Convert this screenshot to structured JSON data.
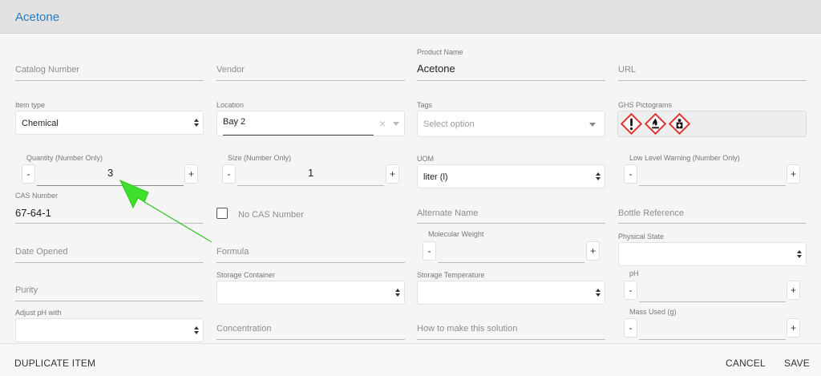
{
  "header": {
    "title": "Acetone"
  },
  "form": {
    "catalog_number": {
      "placeholder": "Catalog Number"
    },
    "vendor": {
      "placeholder": "Vendor"
    },
    "product_name": {
      "label": "Product Name",
      "value": "Acetone"
    },
    "url": {
      "placeholder": "URL"
    },
    "item_type": {
      "label": "Item type",
      "value": "Chemical"
    },
    "location": {
      "label": "Location",
      "value": "Bay 2",
      "clear": "×"
    },
    "tags": {
      "label": "Tags",
      "placeholder": "Select option"
    },
    "ghs": {
      "label": "GHS Pictograms",
      "icons": [
        "exclamation-mark-icon",
        "flame-icon",
        "health-hazard-icon"
      ]
    },
    "quantity": {
      "label": "Quantity (Number Only)",
      "value": "3",
      "minus": "-",
      "plus": "+"
    },
    "size": {
      "label": "Size (Number Only)",
      "value": "1",
      "minus": "-",
      "plus": "+"
    },
    "uom": {
      "label": "UOM",
      "value": "liter (l)"
    },
    "low_level": {
      "label": "Low Level Warning (Number Only)",
      "value": "",
      "minus": "-",
      "plus": "+"
    },
    "cas_number": {
      "label": "CAS Number",
      "value": "67-64-1"
    },
    "no_cas": {
      "label": "No CAS Number",
      "checked": false
    },
    "alternate_name": {
      "placeholder": "Alternate Name"
    },
    "bottle_reference": {
      "placeholder": "Bottle Reference"
    },
    "date_opened": {
      "placeholder": "Date Opened"
    },
    "formula": {
      "placeholder": "Formula"
    },
    "molecular_weight": {
      "label": "Molecular Weight",
      "minus": "-",
      "plus": "+"
    },
    "physical_state": {
      "label": "Physical State"
    },
    "purity": {
      "placeholder": "Purity"
    },
    "storage_container": {
      "label": "Storage Container"
    },
    "storage_temperature": {
      "label": "Storage Temperature"
    },
    "ph": {
      "label": "pH",
      "minus": "-",
      "plus": "+"
    },
    "adjust_ph": {
      "label": "Adjust pH with"
    },
    "concentration": {
      "placeholder": "Concentration"
    },
    "how_to_make": {
      "placeholder": "How to make this solution"
    },
    "mass_used": {
      "label": "Mass Used (g)",
      "minus": "-",
      "plus": "+"
    }
  },
  "footer": {
    "duplicate": "DUPLICATE ITEM",
    "cancel": "CANCEL",
    "save": "SAVE"
  },
  "annotation": {
    "arrow_color": "#3ee02c"
  },
  "colors": {
    "accent": "#2b7bbf",
    "ghs_red": "#e0322c"
  }
}
